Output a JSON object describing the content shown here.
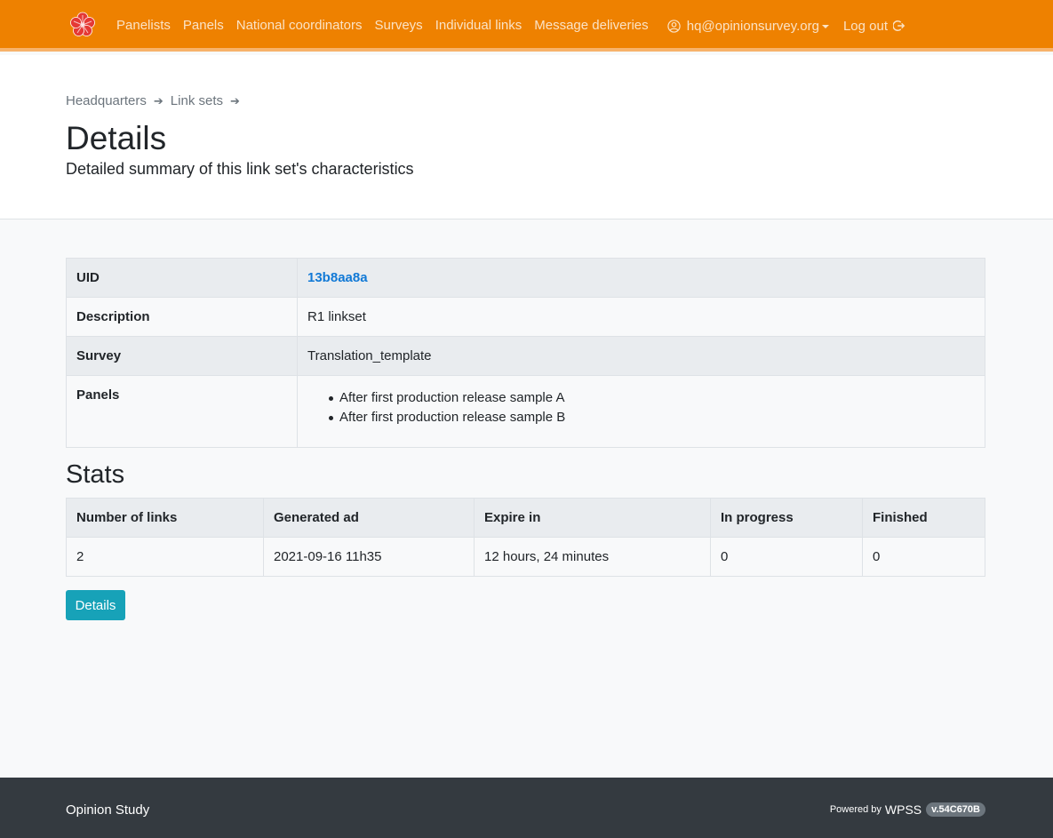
{
  "navbar": {
    "brand_color": "#ee8100",
    "logo_icon": "flower-logo-icon",
    "links": [
      "Panelists",
      "Panels",
      "National coordinators",
      "Surveys",
      "Individual links",
      "Message deliveries"
    ],
    "user_email": "hq@opinionsurvey.org",
    "logout_label": "Log out"
  },
  "breadcrumb": {
    "items": [
      "Headquarters",
      "Link sets"
    ]
  },
  "header": {
    "title": "Details",
    "subtitle": "Detailed summary of this link set's characteristics"
  },
  "details": {
    "uid_label": "UID",
    "uid_value": "13b8aa8a",
    "description_label": "Description",
    "description_value": "R1 linkset",
    "survey_label": "Survey",
    "survey_value": "Translation_template",
    "panels_label": "Panels",
    "panels": [
      "After first production release sample A",
      "After first production release sample B"
    ]
  },
  "stats": {
    "title": "Stats",
    "headers": [
      "Number of links",
      "Generated ad",
      "Expire in",
      "In progress",
      "Finished"
    ],
    "row": [
      "2",
      "2021-09-16 11h35",
      "12 hours, 24 minutes",
      "0",
      "0"
    ]
  },
  "details_button": "Details",
  "footer": {
    "brand": "Opinion Study",
    "powered_by": "Powered by",
    "product": "WPSS",
    "version": "v.54C670B"
  }
}
